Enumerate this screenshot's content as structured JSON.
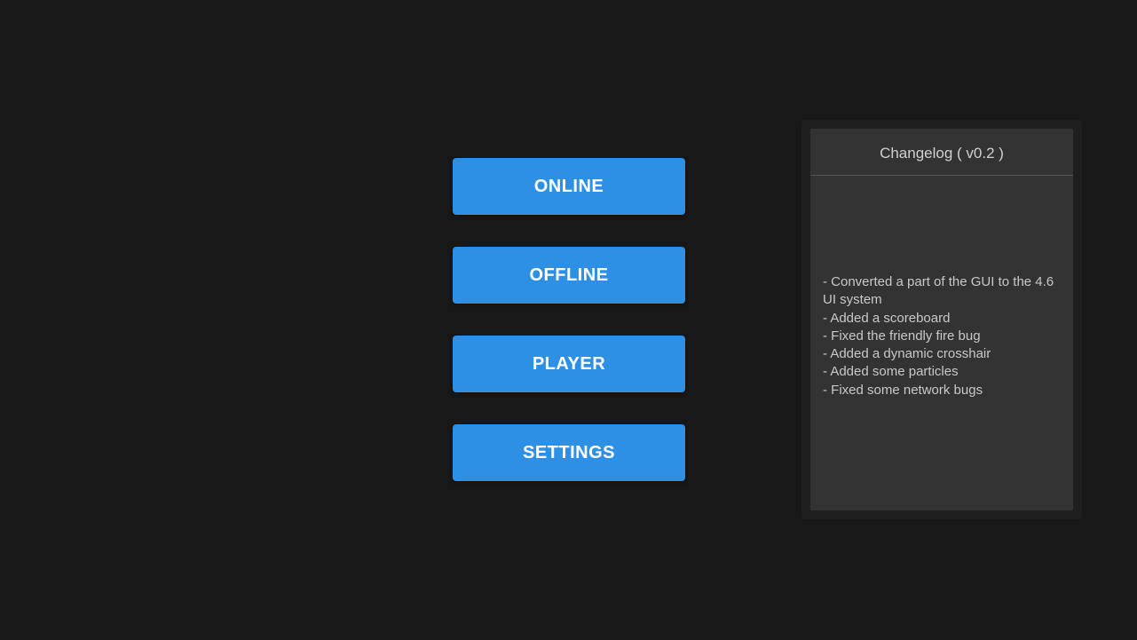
{
  "menu": {
    "buttons": [
      {
        "label": "ONLINE"
      },
      {
        "label": "OFFLINE"
      },
      {
        "label": "PLAYER"
      },
      {
        "label": "SETTINGS"
      }
    ]
  },
  "changelog": {
    "title": "Changelog ( v0.2 )",
    "items": [
      "- Converted a part of the GUI to the 4.6 UI system",
      "- Added a scoreboard",
      "- Fixed the friendly fire bug",
      "- Added a dynamic crosshair",
      "- Added some particles",
      "- Fixed some network bugs"
    ]
  }
}
